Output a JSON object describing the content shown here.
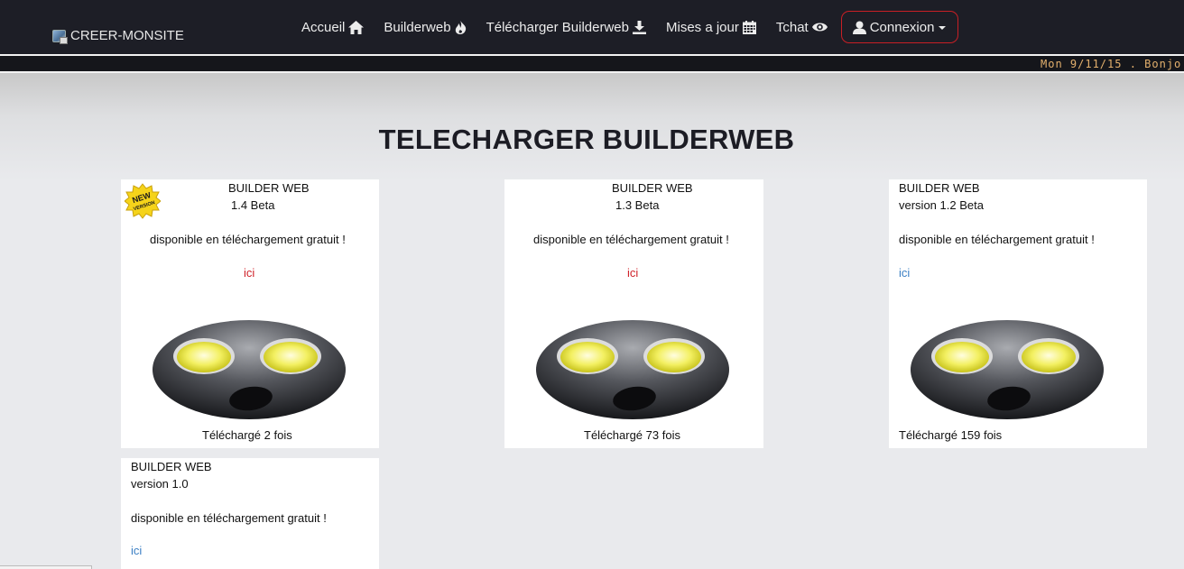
{
  "nav": {
    "brand": "CREER-MONSITE",
    "items": [
      {
        "label": "Accueil",
        "icon": "home-icon"
      },
      {
        "label": "Builderweb",
        "icon": "fire-icon"
      },
      {
        "label": "Télécharger Builderweb",
        "icon": "download-icon"
      },
      {
        "label": "Mises a jour",
        "icon": "calendar-icon"
      },
      {
        "label": "Tchat",
        "icon": "eye-icon"
      }
    ],
    "login": {
      "label": "Connexion",
      "icon": "user-icon"
    }
  },
  "ticker": "Mon 9/11/15 . Bonjo",
  "page_title": "TELECHARGER BUILDERWEB",
  "cards": [
    {
      "name": "BUILDER WEB",
      "version": "1.4 Beta",
      "desc": "disponible en téléchargement gratuit !",
      "link": "ici",
      "downloads": "Téléchargé 2 fois",
      "badge": "NEW VERSION"
    },
    {
      "name": "BUILDER WEB",
      "version": "1.3 Beta",
      "desc": "disponible en téléchargement gratuit !",
      "link": "ici",
      "downloads": "Téléchargé 73 fois"
    },
    {
      "name": "BUILDER WEB",
      "version": "version 1.2 Beta",
      "desc": "disponible en téléchargement gratuit !",
      "link": "ici",
      "downloads": "Téléchargé 159 fois"
    },
    {
      "name": "BUILDER WEB",
      "version": "version 1.0",
      "desc": "disponible en téléchargement gratuit !",
      "link": "ici"
    }
  ],
  "colors": {
    "navbar": "#1d1e26",
    "accent": "#c81f25",
    "ticker": "#e3b06d",
    "link_red": "#d0232a",
    "link_blue": "#3b7fc4"
  }
}
